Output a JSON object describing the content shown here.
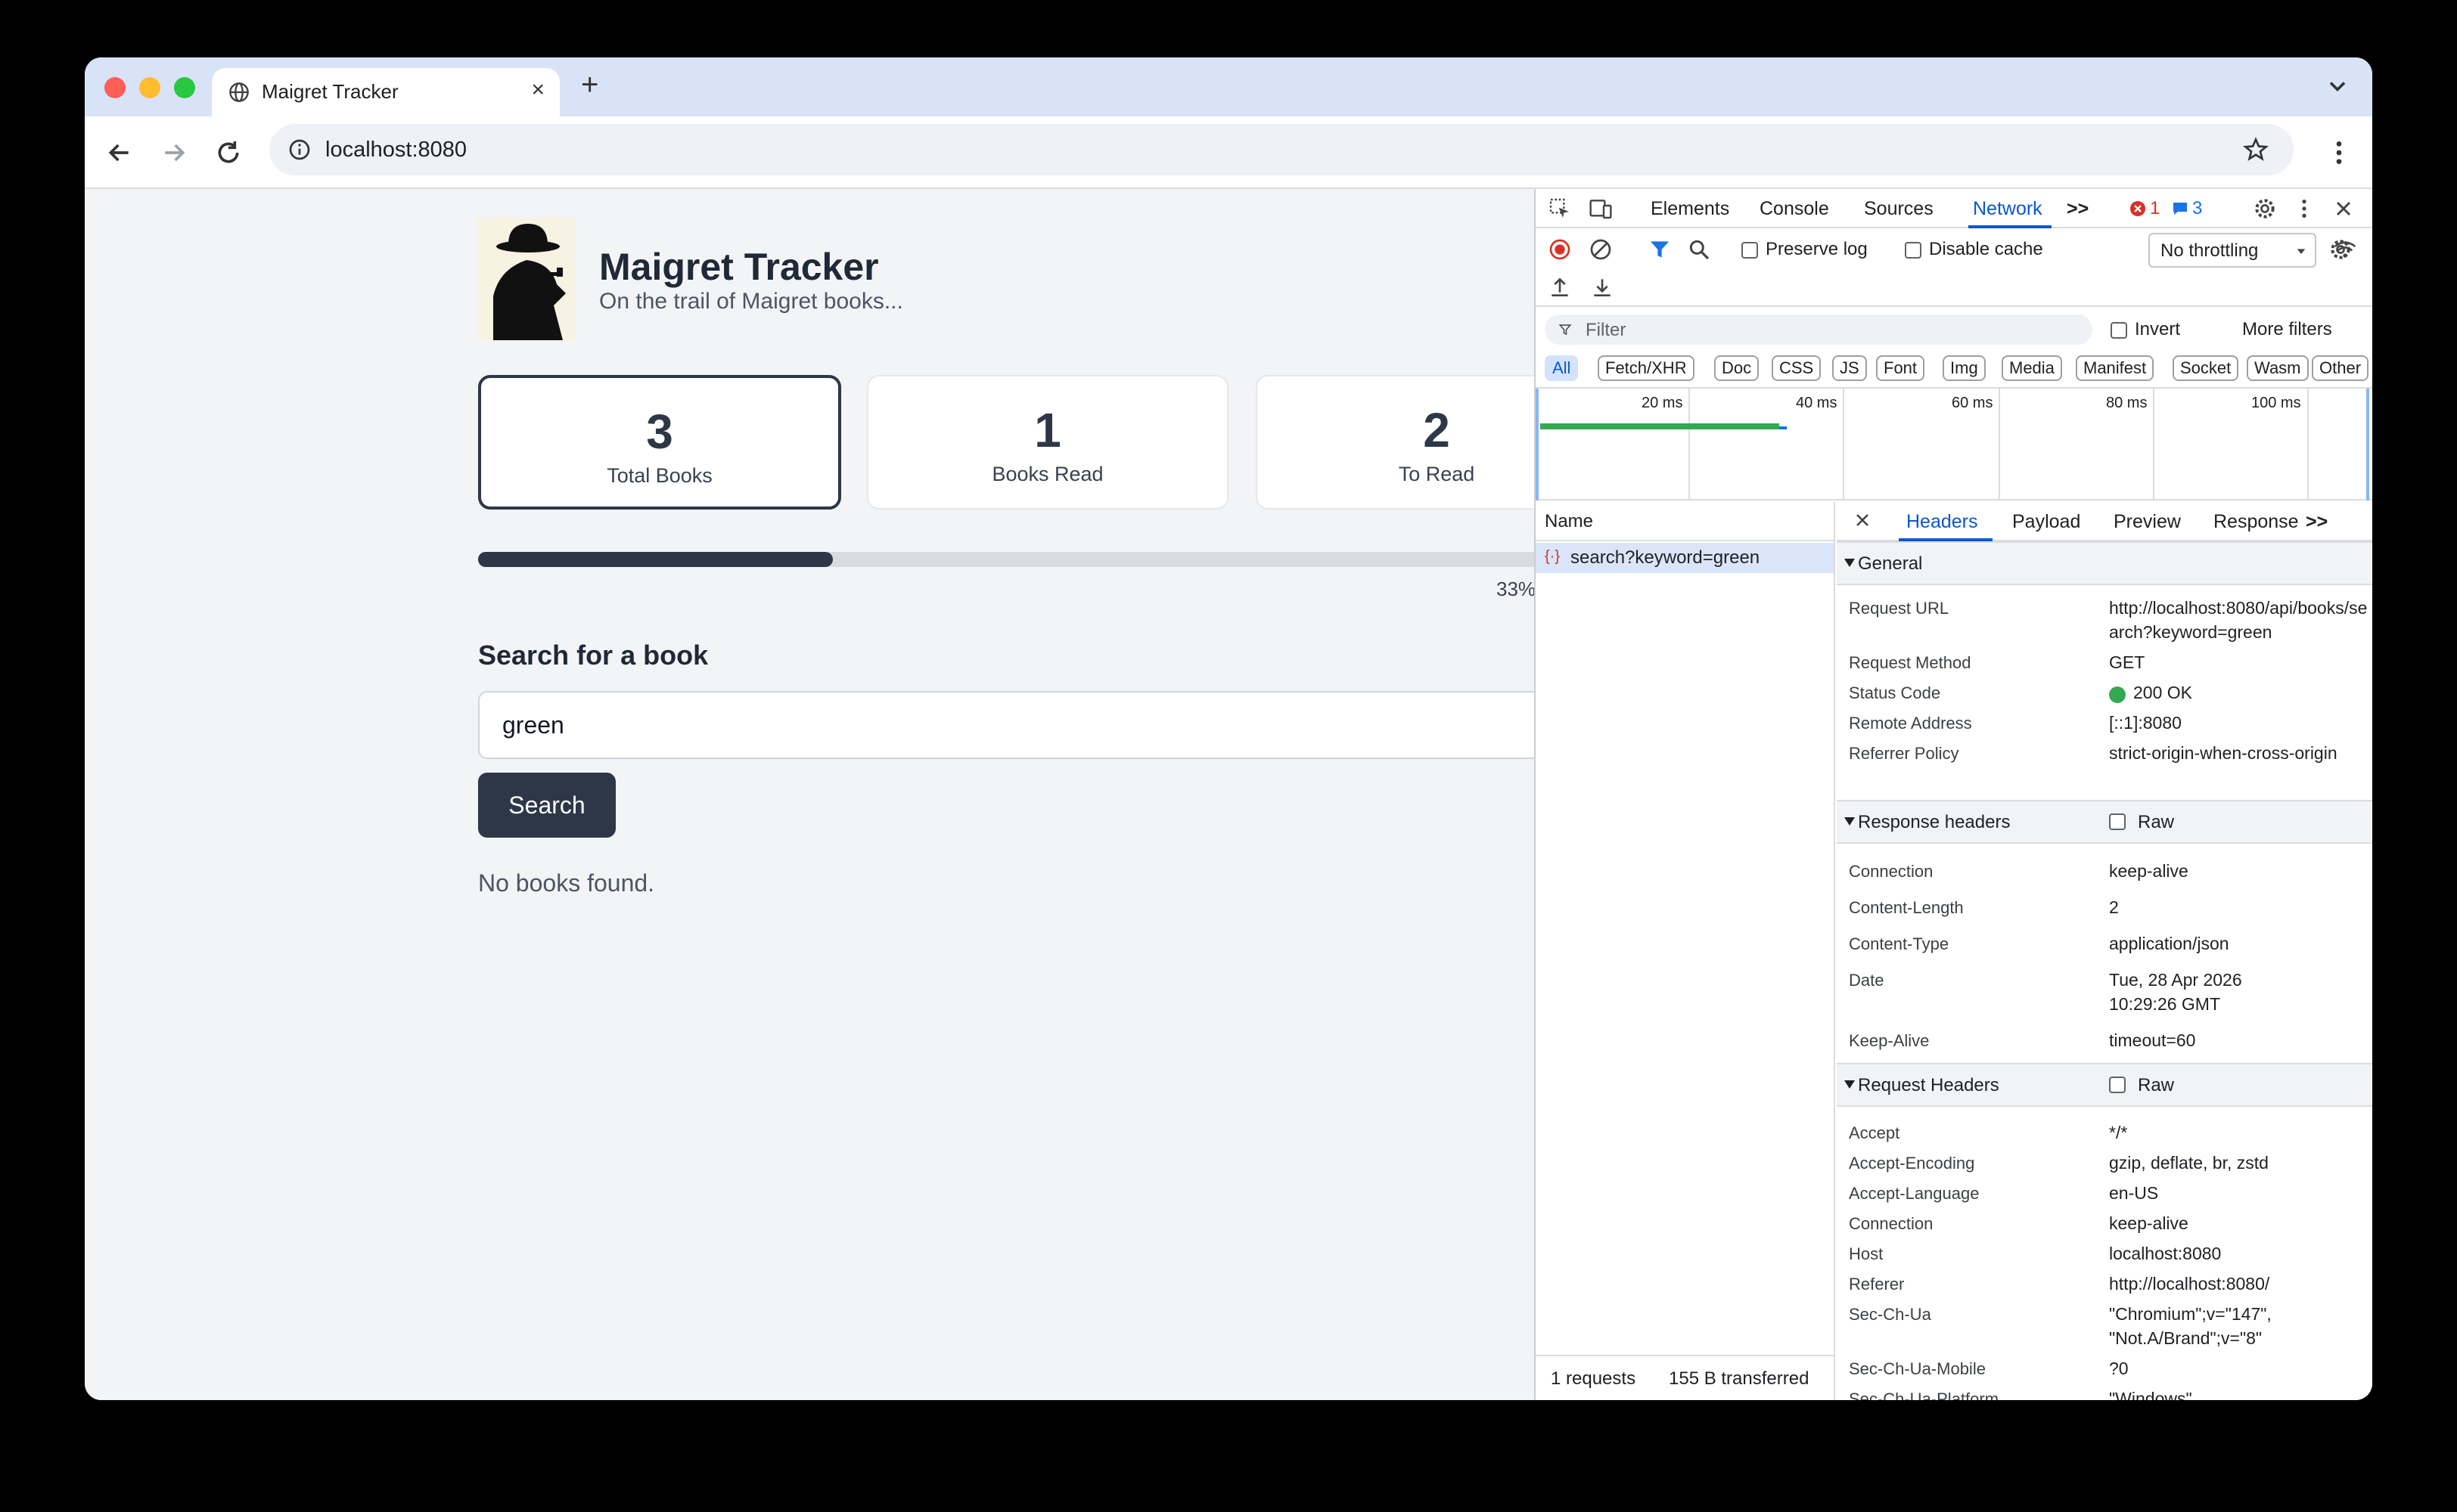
{
  "browser": {
    "tab_title": "Maigret Tracker",
    "url": "localhost:8080",
    "new_tab_symbol": "+",
    "close_symbol": "×"
  },
  "app": {
    "title": "Maigret Tracker",
    "tagline": "On the trail of Maigret books...",
    "stats": [
      {
        "value": "3",
        "label": "Total Books"
      },
      {
        "value": "1",
        "label": "Books Read"
      },
      {
        "value": "2",
        "label": "To Read"
      }
    ],
    "progress_fraction": 0.33,
    "progress_text": "33%",
    "search_heading": "Search for a book",
    "search_value": "green",
    "search_button": "Search",
    "result_text": "No books found."
  },
  "devtools": {
    "tabs": [
      "Elements",
      "Console",
      "Sources",
      "Network"
    ],
    "more_tabs": ">>",
    "error_count": "1",
    "message_count": "3",
    "preserve_log": "Preserve log",
    "disable_cache": "Disable cache",
    "throttling": "No throttling",
    "filter_placeholder": "Filter",
    "invert": "Invert",
    "more_filters": "More filters",
    "type_filters": [
      "All",
      "Fetch/XHR",
      "Doc",
      "CSS",
      "JS",
      "Font",
      "Img",
      "Media",
      "Manifest",
      "Socket",
      "Wasm",
      "Other"
    ],
    "timeline_ticks": [
      "20 ms",
      "40 ms",
      "60 ms",
      "80 ms",
      "100 ms"
    ],
    "name_header": "Name",
    "request_name": "search?keyword=green",
    "summary_requests": "1 requests",
    "summary_transferred": "155 B transferred",
    "detail_tabs": [
      "Headers",
      "Payload",
      "Preview",
      "Response"
    ],
    "general_title": "General",
    "general": [
      {
        "key": "Request URL",
        "value": "http://localhost:8080/api/books/search?keyword=green"
      },
      {
        "key": "Request Method",
        "value": "GET"
      },
      {
        "key": "Status Code",
        "value": "200 OK"
      },
      {
        "key": "Remote Address",
        "value": "[::1]:8080"
      },
      {
        "key": "Referrer Policy",
        "value": "strict-origin-when-cross-origin"
      }
    ],
    "response_headers_title": "Response headers",
    "raw_label": "Raw",
    "response_headers": [
      {
        "key": "Connection",
        "value": "keep-alive"
      },
      {
        "key": "Content-Length",
        "value": "2"
      },
      {
        "key": "Content-Type",
        "value": "application/json"
      },
      {
        "key": "Date",
        "value": "Tue, 28 Apr 2026 10:29:26 GMT"
      },
      {
        "key": "Keep-Alive",
        "value": "timeout=60"
      }
    ],
    "request_headers_title": "Request Headers",
    "request_headers": [
      {
        "key": "Accept",
        "value": "*/*"
      },
      {
        "key": "Accept-Encoding",
        "value": "gzip, deflate, br, zstd"
      },
      {
        "key": "Accept-Language",
        "value": "en-US"
      },
      {
        "key": "Connection",
        "value": "keep-alive"
      },
      {
        "key": "Host",
        "value": "localhost:8080"
      },
      {
        "key": "Referer",
        "value": "http://localhost:8080/"
      },
      {
        "key": "Sec-Ch-Ua",
        "value": "\"Chromium\";v=\"147\", \"Not.A/Brand\";v=\"8\""
      },
      {
        "key": "Sec-Ch-Ua-Mobile",
        "value": "?0"
      },
      {
        "key": "Sec-Ch-Ua-Platform",
        "value": "\"Windows\""
      }
    ]
  },
  "colors": {
    "accent": "#2d3748",
    "devtools_blue": "#0b57d0",
    "status_ok": "#34a853"
  }
}
